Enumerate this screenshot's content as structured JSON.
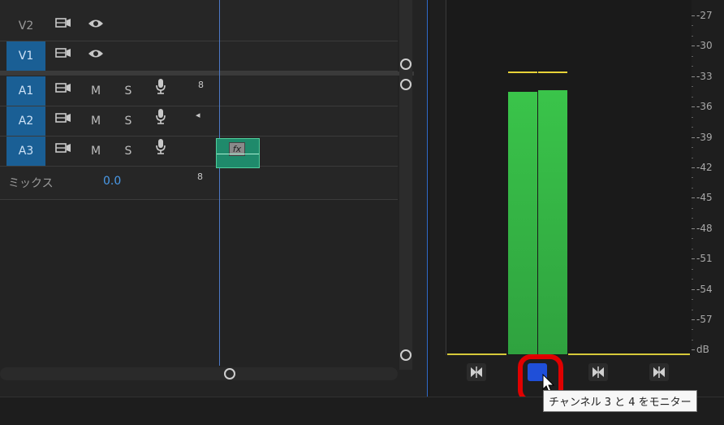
{
  "tracks": {
    "video": [
      {
        "name": "V2",
        "active": false
      },
      {
        "name": "V1",
        "active": true
      }
    ],
    "audio": [
      {
        "name": "A1",
        "mute": "M",
        "solo": "S",
        "extra": "8"
      },
      {
        "name": "A2",
        "mute": "M",
        "solo": "S",
        "extra": "◂"
      },
      {
        "name": "A3",
        "mute": "M",
        "solo": "S",
        "extra": ""
      }
    ],
    "mix": {
      "label": "ミックス",
      "value": "0.0",
      "extra": "8"
    }
  },
  "clip": {
    "fx_label": "fx"
  },
  "meter": {
    "scale": [
      "-27",
      "-30",
      "-33",
      "-36",
      "-39",
      "-42",
      "-45",
      "-48",
      "-51",
      "-54",
      "-57",
      "dB"
    ],
    "channels": [
      {
        "level_db": -34.5,
        "peak_db": -32.5
      },
      {
        "level_db": -34.4,
        "peak_db": -32.5
      }
    ],
    "bar_color": "#3ac44a",
    "peak_color": "#e7d238"
  },
  "tooltip": {
    "text": "チャンネル 3 と 4 をモニター"
  },
  "colors": {
    "accent": "#1a5f95",
    "highlight": "#e00000",
    "selected_solo": "#1f4fd8"
  }
}
